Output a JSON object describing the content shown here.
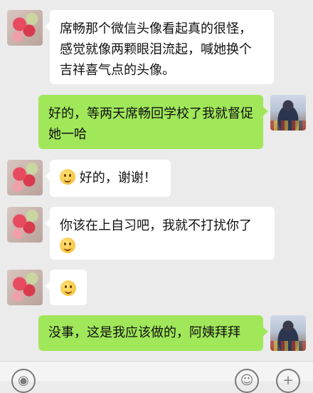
{
  "messages": [
    {
      "side": "left",
      "text": "席畅那个微信头像看起真的很怪，感觉就像两颗眼泪流起，喊她换个吉祥喜气点的头像。"
    },
    {
      "side": "right",
      "text": "好的，等两天席畅回学校了我就督促她一哈"
    },
    {
      "side": "left",
      "text": "好的，谢谢！",
      "emoji": "smile-emoji"
    },
    {
      "side": "left",
      "text": "你该在上自习吧，我就不打扰你了",
      "emoji": "smile-emoji"
    },
    {
      "side": "left",
      "text": "",
      "emoji": "thinking-emoji"
    },
    {
      "side": "right",
      "text": "没事，这是我应该做的，阿姨拜拜"
    }
  ],
  "input_bar": {
    "voice_icon": "voice-icon",
    "emoji_icon": "emoji-icon",
    "plus_icon": "plus-icon"
  }
}
